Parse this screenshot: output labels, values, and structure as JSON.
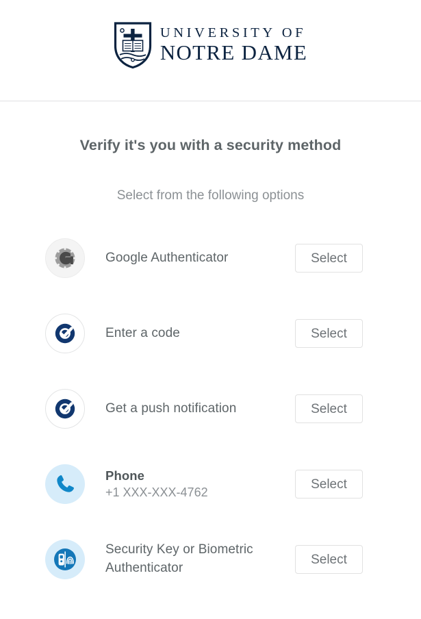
{
  "header": {
    "logo_icon": "notre-dame-shield-icon",
    "logo_line1": "UNIVERSITY OF",
    "logo_line2": "NOTRE DAME",
    "logo_color": "#0c2340"
  },
  "main": {
    "title": "Verify it's you with a security method",
    "subtitle": "Select from the following options"
  },
  "options": [
    {
      "icon": "google-authenticator-icon",
      "icon_style": "ga",
      "title": "Google Authenticator",
      "subtitle": "",
      "button_label": "Select",
      "icon_color": "#9aa0a4"
    },
    {
      "icon": "okta-verify-check-icon",
      "icon_style": "okta",
      "title": "Enter a code",
      "subtitle": "",
      "button_label": "Select",
      "icon_color": "#11376f"
    },
    {
      "icon": "okta-verify-check-icon",
      "icon_style": "okta",
      "title": "Get a push notification",
      "subtitle": "",
      "button_label": "Select",
      "icon_color": "#11376f"
    },
    {
      "icon": "phone-handset-icon",
      "icon_style": "phone",
      "title": "Phone",
      "subtitle": "+1 XXX-XXX-4762",
      "button_label": "Select",
      "icon_color": "#1087c8"
    },
    {
      "icon": "security-key-fingerprint-icon",
      "icon_style": "seckey",
      "title": "Security Key or Biometric Authenticator",
      "subtitle": "",
      "button_label": "Select",
      "icon_color": "#1477b8"
    }
  ],
  "colors": {
    "brand_navy": "#0c2340",
    "okta_blue": "#11376f",
    "accent_blue": "#1087c8",
    "light_blue_bg": "#d6ecfa",
    "text_primary": "#5e6568",
    "text_secondary": "#8b9094",
    "border": "#e1e1e1",
    "divider": "#dfe1e2"
  }
}
